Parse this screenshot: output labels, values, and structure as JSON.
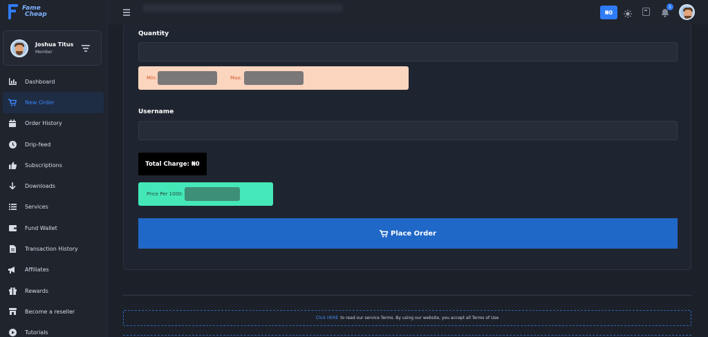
{
  "brand": {
    "line1": "Fame",
    "line2": "Cheap"
  },
  "user": {
    "name": "Joshua Titus",
    "role": "Member"
  },
  "sidebar": {
    "items": [
      {
        "label": "Dashboard",
        "icon": "chart-icon"
      },
      {
        "label": "New Order",
        "icon": "cart-icon",
        "active": true
      },
      {
        "label": "Order History",
        "icon": "calendar-icon"
      },
      {
        "label": "Drip-feed",
        "icon": "clock-icon"
      },
      {
        "label": "Subscriptions",
        "icon": "thumbs-up-icon"
      },
      {
        "label": "Downloads",
        "icon": "arrow-down-icon"
      },
      {
        "label": "Services",
        "icon": "list-icon"
      },
      {
        "label": "Fund Wallet",
        "icon": "wallet-icon"
      },
      {
        "label": "Transaction History",
        "icon": "file-icon"
      },
      {
        "label": "Affiliates",
        "icon": "megaphone-icon"
      },
      {
        "label": "Rewards",
        "icon": "gift-icon"
      },
      {
        "label": "Become a reseller",
        "icon": "store-icon"
      },
      {
        "label": "Tutorials",
        "icon": "play-icon"
      }
    ]
  },
  "header": {
    "balance": "₦0",
    "notification_count": "1"
  },
  "form": {
    "quantity_label": "Quantity",
    "min_label": "Min:",
    "max_label": "Max:",
    "username_label": "Username",
    "total_charge": "Total Charge: ₦0",
    "price_label": "Price Per 1000:",
    "place_order_label": "Place Order"
  },
  "footer": {
    "link_text": "Click HERE",
    "terms_text": "to read our service Terms. By using our website, you accept all Terms of Use"
  },
  "colors": {
    "accent": "#2f7bf6",
    "place_order": "#2068c8",
    "minmax_bg": "#fcd5bf",
    "price_bg": "#44e8b8"
  }
}
